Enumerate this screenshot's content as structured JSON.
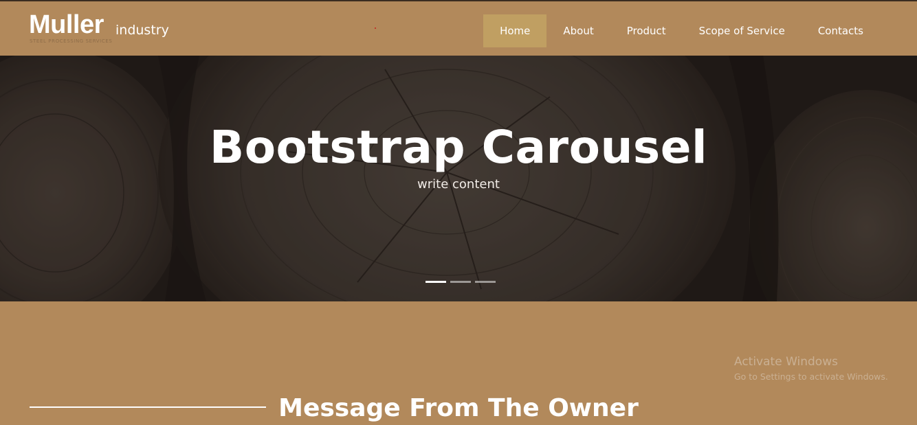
{
  "header": {
    "logo": {
      "main": "Muller",
      "sub": "industry",
      "tagline": "STEEL PROCESSING SERVICES"
    },
    "nav": [
      {
        "label": "Home",
        "active": true
      },
      {
        "label": "About",
        "active": false
      },
      {
        "label": "Product",
        "active": false
      },
      {
        "label": "Scope of Service",
        "active": false
      },
      {
        "label": "Contacts",
        "active": false
      }
    ]
  },
  "carousel": {
    "title": "Bootstrap Carousel",
    "caption": "write content",
    "slide_count": 3,
    "active_slide": 1
  },
  "section": {
    "title": "Message From The Owner"
  },
  "watermark": {
    "title": "Activate Windows",
    "subtitle": "Go to Settings to activate Windows."
  },
  "colors": {
    "brand": "#b2895b",
    "nav_active": "#c09f62",
    "carousel_bg": "#2a211d"
  }
}
